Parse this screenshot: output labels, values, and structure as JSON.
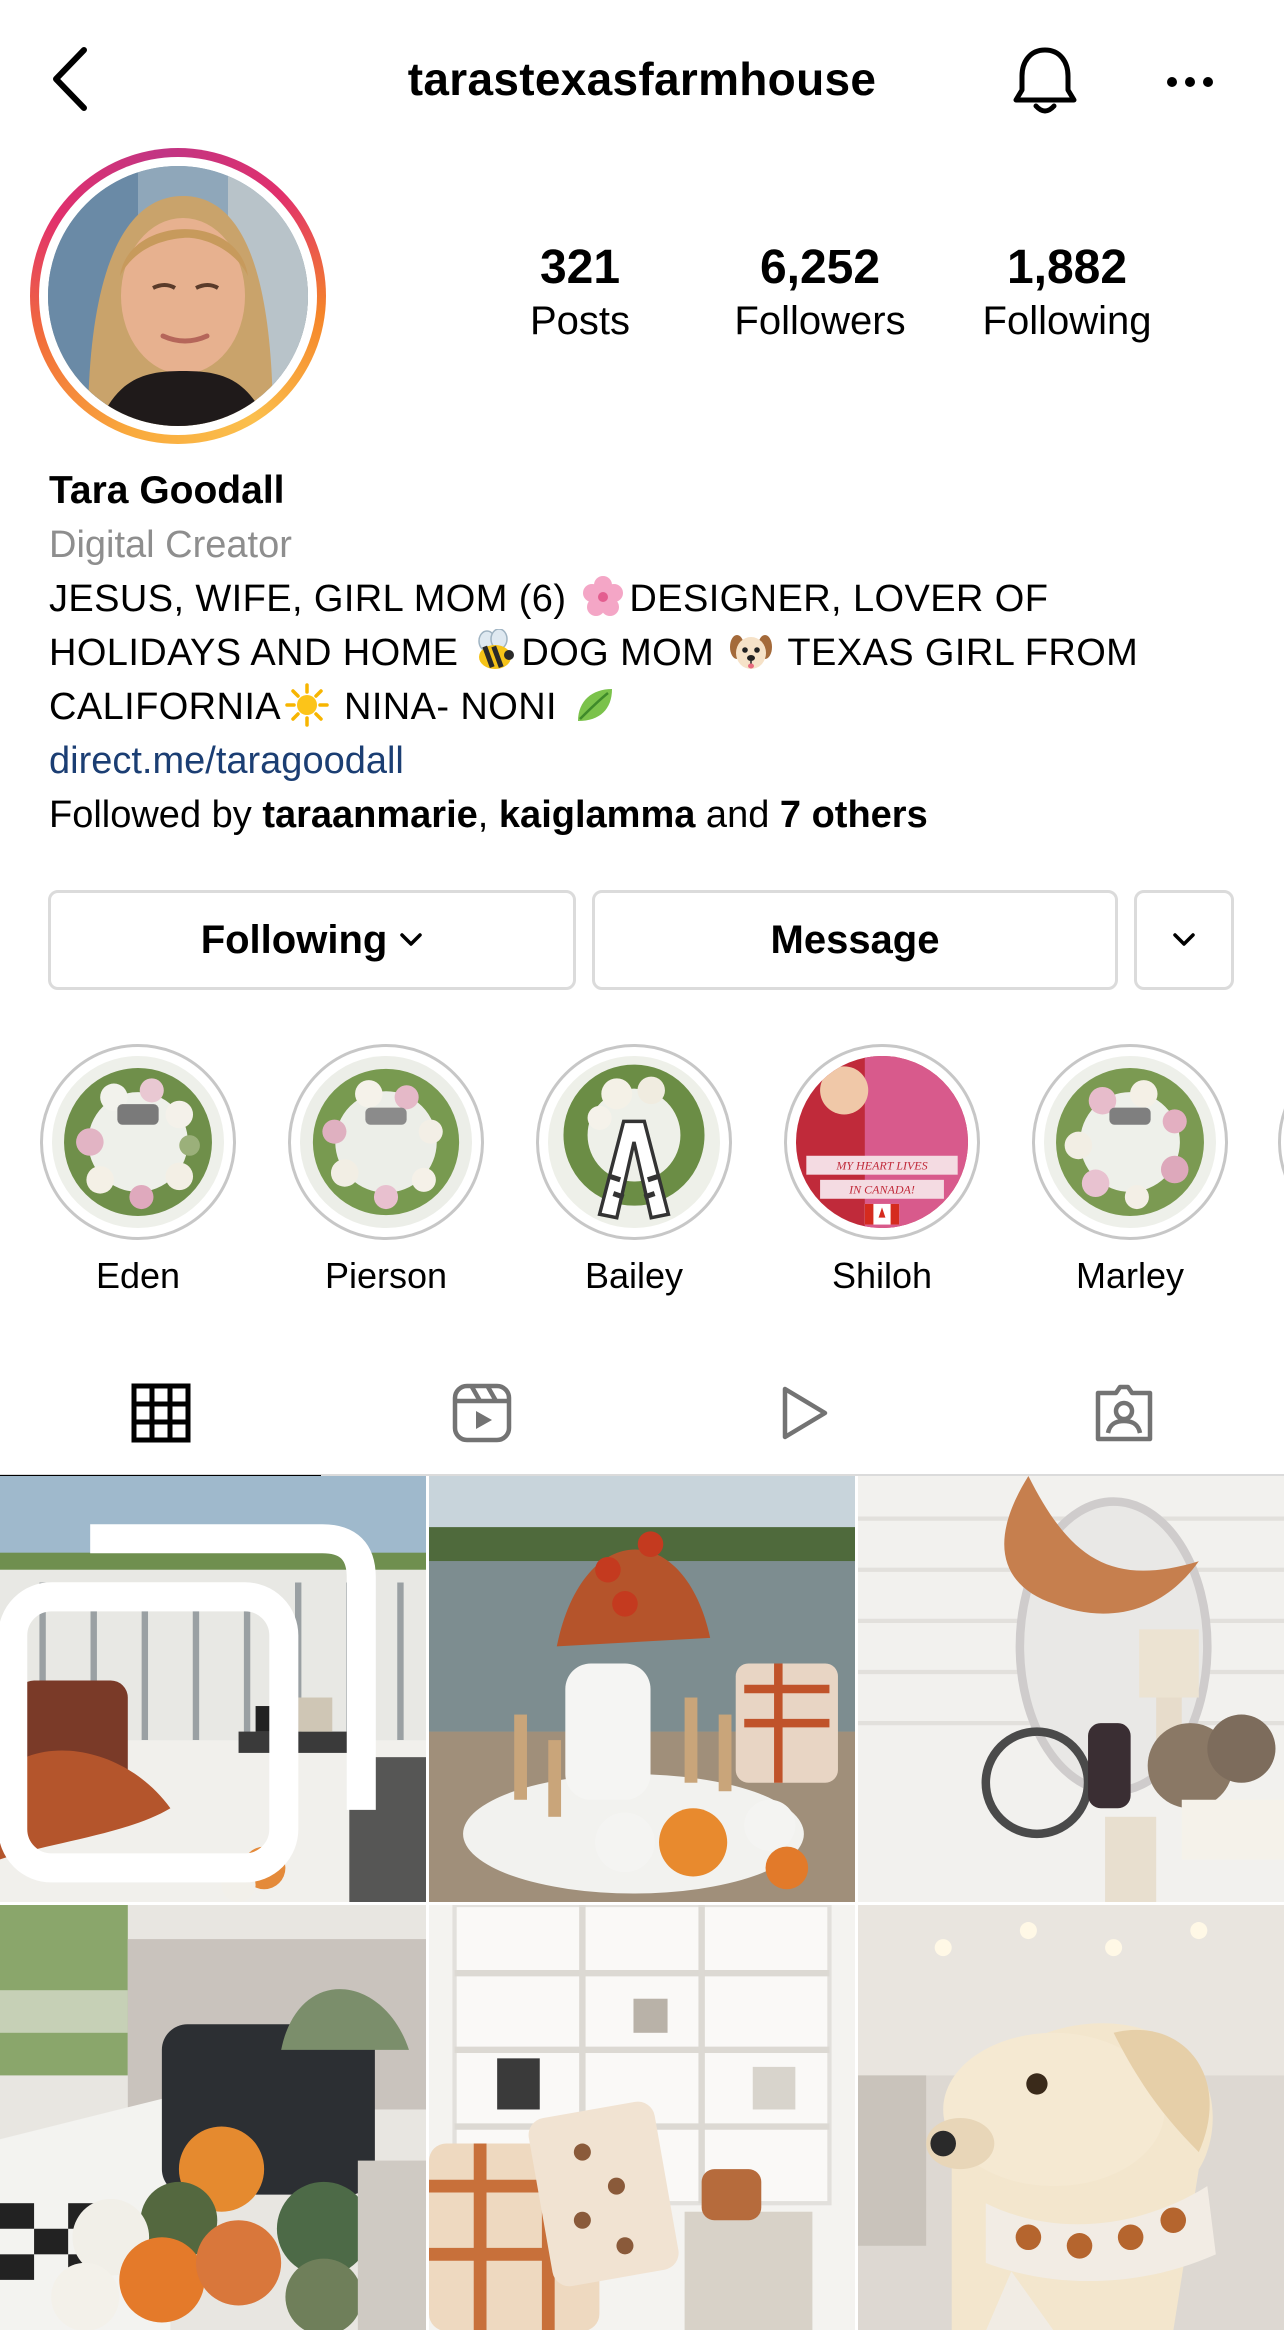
{
  "header": {
    "username": "tarastexasfarmhouse"
  },
  "profile": {
    "stats": [
      {
        "value": "321",
        "label": "Posts"
      },
      {
        "value": "6,252",
        "label": "Followers"
      },
      {
        "value": "1,882",
        "label": "Following"
      }
    ],
    "name": "Tara Goodall",
    "category": "Digital Creator",
    "bio_line1_a": "JESUS, WIFE, GIRL MOM (6) ",
    "bio_line1_b": "DESIGNER, LOVER OF",
    "bio_line2_a": "HOLIDAYS AND HOME ",
    "bio_line2_b": "DOG MOM ",
    "bio_line2_c": " TEXAS GIRL FROM",
    "bio_line3_a": "CALIFORNIA",
    "bio_line3_b": " NINA- NONI ",
    "link": "direct.me/taragoodall",
    "followed_by_prefix": "Followed by ",
    "followed_by_user1": "taraanmarie",
    "followed_by_sep": ", ",
    "followed_by_user2": "kaiglamma",
    "followed_by_and": " and ",
    "followed_by_others": "7 others"
  },
  "actions": {
    "following_label": "Following",
    "message_label": "Message"
  },
  "highlights": [
    {
      "label": "Eden"
    },
    {
      "label": "Pierson"
    },
    {
      "label": "Bailey"
    },
    {
      "label": "Shiloh",
      "overlay_text_1": "MY HEART LIVES",
      "overlay_text_2": "IN CANADA!"
    },
    {
      "label": "Marley"
    }
  ],
  "tabs": [
    {
      "icon": "grid-icon",
      "active": true
    },
    {
      "icon": "reels-icon",
      "active": false
    },
    {
      "icon": "video-play-icon",
      "active": false
    },
    {
      "icon": "tagged-icon",
      "active": false
    }
  ],
  "colors": {
    "link": "#1b3e73",
    "muted": "#8e8e8e",
    "border": "#dbdbdb"
  }
}
